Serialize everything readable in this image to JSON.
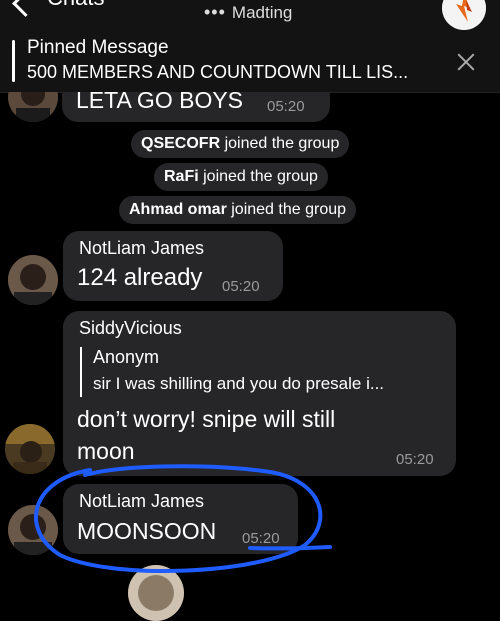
{
  "header": {
    "back_label": "Chats",
    "status": "Madting"
  },
  "pinned": {
    "title": "Pinned Message",
    "text": "500 MEMBERS AND COUNTDOWN TILL LIS..."
  },
  "messages": {
    "m0": {
      "text": "LETA GO BOYS",
      "time": "05:20"
    },
    "joins": [
      {
        "name": "QSECOFR",
        "text": "joined the group"
      },
      {
        "name": "RaFi",
        "text": "joined the group"
      },
      {
        "name": "Ahmad omar",
        "text": "joined the group"
      }
    ],
    "m1": {
      "sender": "NotLiam James",
      "text": "124 already",
      "time": "05:20"
    },
    "m2": {
      "sender": "SiddyVicious",
      "reply_name": "Anonym",
      "reply_text": "sir I was shilling and you do presale i...",
      "line1": "don’t worry! snipe will still",
      "line2": "moon",
      "time": "05:20"
    },
    "m3": {
      "sender": "NotLiam James",
      "text": "MOONSOON",
      "time": "05:20"
    }
  },
  "colors": {
    "background": "#000000",
    "bubble": "#262628",
    "sender_orange": "#f0a05a",
    "sender_cyan": "#4dd3e0",
    "doodle_blue": "#1f5cff"
  },
  "icons": [
    "back-chevron-icon",
    "close-icon",
    "typing-dots-icon"
  ]
}
